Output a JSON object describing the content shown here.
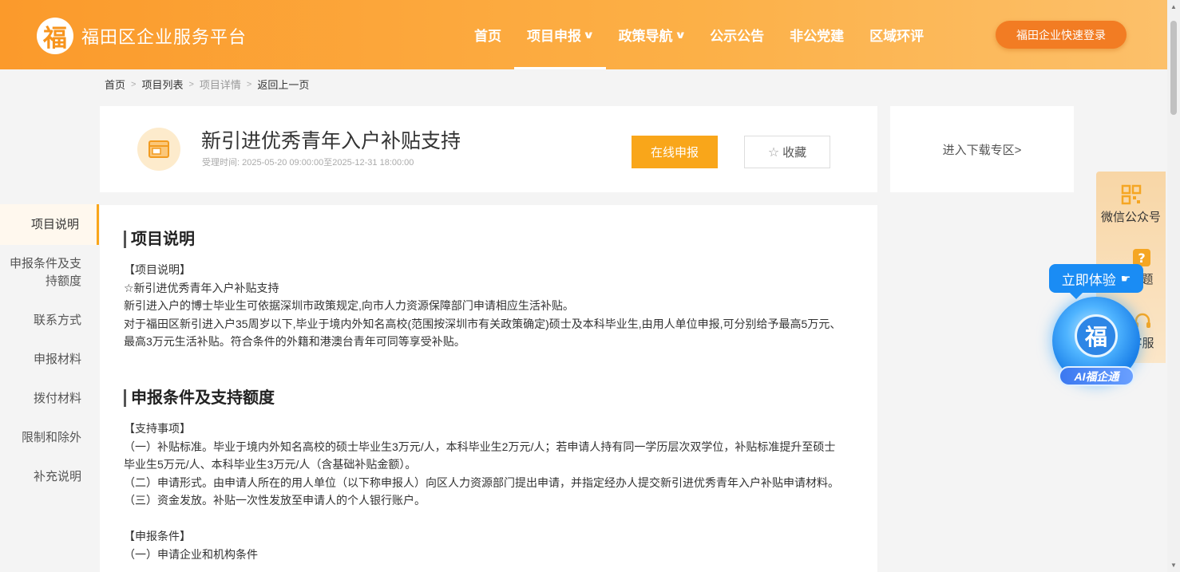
{
  "header": {
    "logo_char": "福",
    "site_name": "福田区企业服务平台",
    "nav": [
      {
        "label": "首页",
        "has_dropdown": false,
        "active": false
      },
      {
        "label": "项目申报",
        "has_dropdown": true,
        "active": true
      },
      {
        "label": "政策导航",
        "has_dropdown": true,
        "active": false
      },
      {
        "label": "公示公告",
        "has_dropdown": false,
        "active": false
      },
      {
        "label": "非公党建",
        "has_dropdown": false,
        "active": false
      },
      {
        "label": "区域环评",
        "has_dropdown": false,
        "active": false
      }
    ],
    "login_label": "福田企业快速登录",
    "brand_color": "#fb9a2b"
  },
  "breadcrumb": {
    "home": "首页",
    "list": "项目列表",
    "detail": "项目详情",
    "back": "返回上一页"
  },
  "project": {
    "title": "新引进优秀青年入户补贴支持",
    "time": "受理时间:  2025-05-20 09:00:00至2025-12-31 18:00:00",
    "apply_label": "在线申报",
    "fav_label": "收藏"
  },
  "download": {
    "label": "进入下载专区>"
  },
  "sidenav": [
    {
      "label": "项目说明",
      "active": true
    },
    {
      "label": "申报条件及支持额度",
      "active": false
    },
    {
      "label": "联系方式",
      "active": false
    },
    {
      "label": "申报材料",
      "active": false
    },
    {
      "label": "拨付材料",
      "active": false
    },
    {
      "label": "限制和除外",
      "active": false
    },
    {
      "label": "补充说明",
      "active": false
    }
  ],
  "sections": {
    "intro": {
      "title": "项目说明",
      "lines": [
        "【项目说明】",
        "☆新引进优秀青年入户补贴支持",
        "新引进入户的博士毕业生可依据深圳市政策规定,向市人力资源保障部门申请相应生活补贴。",
        "对于福田区新引进入户35周岁以下,毕业于境内外知名高校(范围按深圳市有关政策确定)硕士及本科毕业生,由用人单位申报,可分别给予最高5万元、最高3万元生活补贴。符合条件的外籍和港澳台青年可同等享受补贴。"
      ]
    },
    "conditions": {
      "title": "申报条件及支持额度",
      "lines": [
        "【支持事项】",
        "（一）补贴标准。毕业于境内外知名高校的硕士毕业生3万元/人，本科毕业生2万元/人；若申请人持有同一学历层次双学位，补贴标准提升至硕士毕业生5万元/人、本科毕业生3万元/人（含基础补贴金额）。",
        "（二）申请形式。由申请人所在的用人单位（以下称申报人）向区人力资源部门提出申请，并指定经办人提交新引进优秀青年入户补贴申请材料。",
        "（三）资金发放。补贴一次性发放至申请人的个人银行账户。",
        "",
        "【申报条件】",
        "（一）申请企业和机构条件"
      ]
    }
  },
  "float_panel": {
    "wechat": "微信公众号",
    "faq": "问题",
    "service": "客服"
  },
  "ai": {
    "bubble": "立即体验",
    "orb_char": "福",
    "label": "AI福企通"
  }
}
